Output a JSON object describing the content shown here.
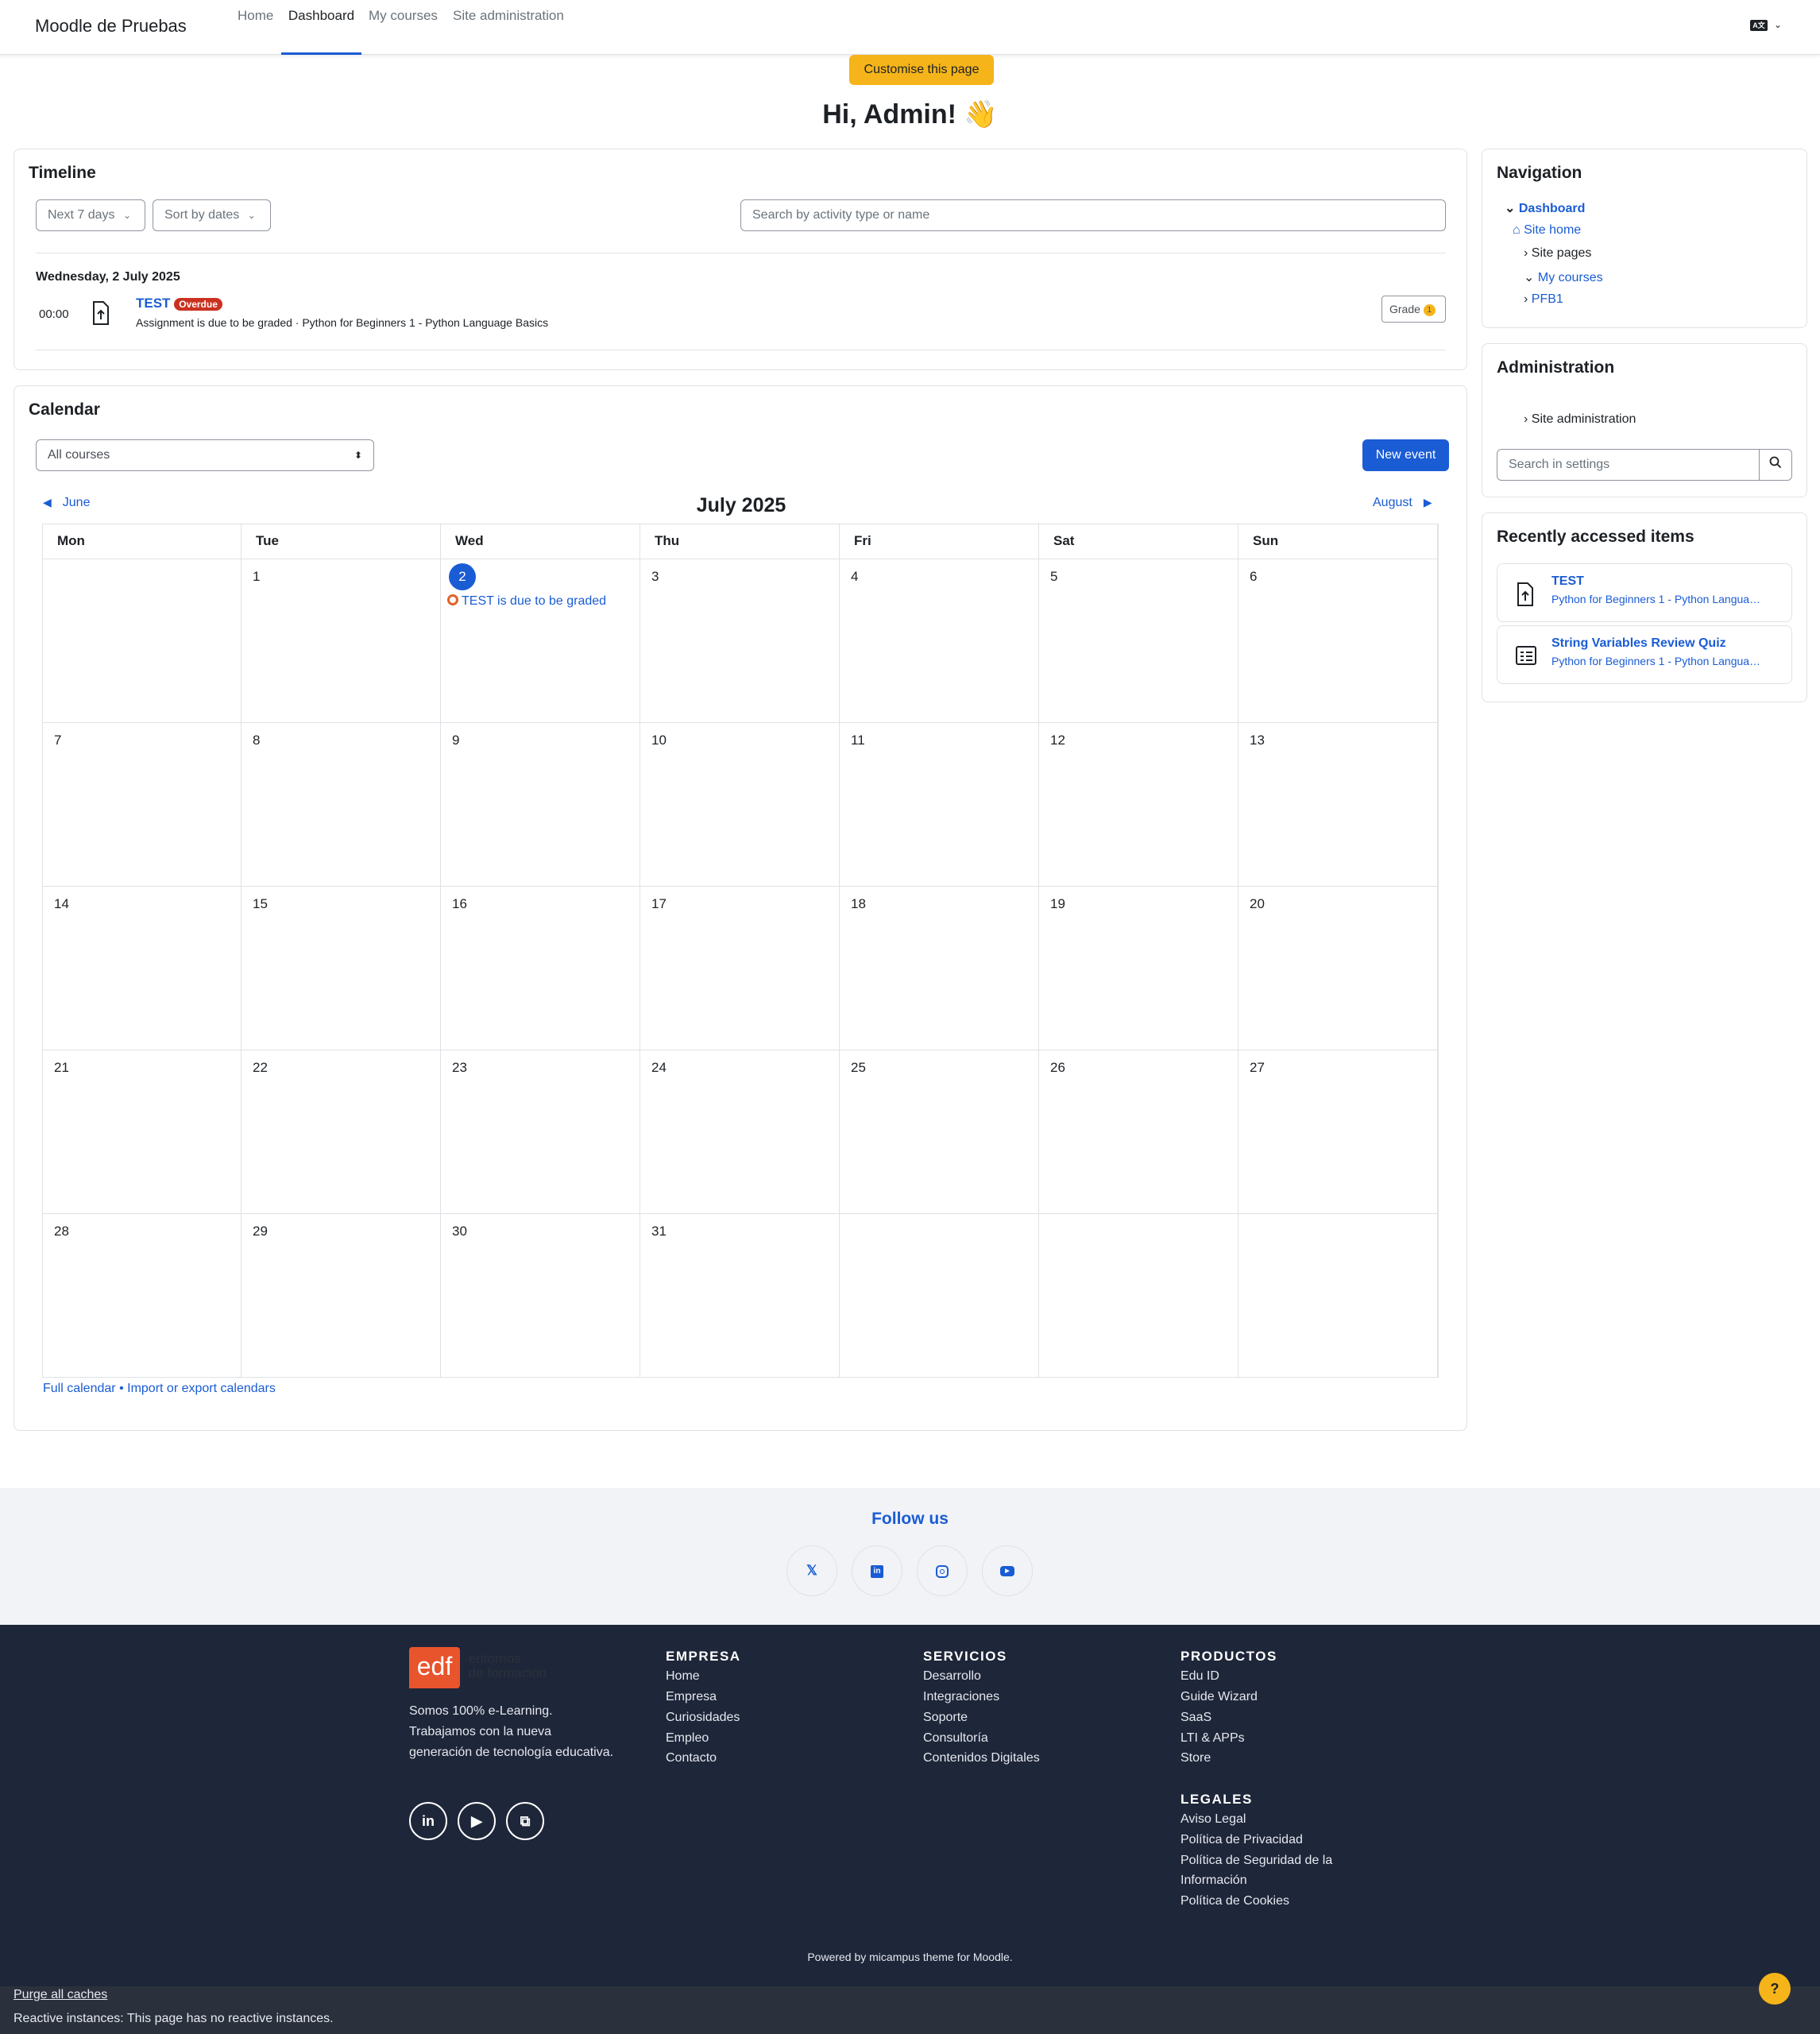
{
  "navbar": {
    "brand": "Moodle de Pruebas",
    "items": [
      {
        "label": "Home"
      },
      {
        "label": "Dashboard"
      },
      {
        "label": "My courses"
      },
      {
        "label": "Site administration"
      }
    ],
    "lang_icon": "language-icon"
  },
  "page": {
    "customise_label": "Customise this page",
    "greeting": "Hi, Admin! 👋"
  },
  "timeline": {
    "title": "Timeline",
    "filter_label": "Next 7 days",
    "sort_label": "Sort by dates",
    "search_placeholder": "Search by activity type or name",
    "date_heading": "Wednesday, 2 July 2025",
    "event": {
      "time": "00:00",
      "name": "TEST",
      "badge": "Overdue",
      "description": "Assignment is due to be graded · Python for Beginners 1 - Python Language Basics",
      "action": "Grade",
      "action_count": "1"
    }
  },
  "calendar": {
    "title": "Calendar",
    "course_select": "All courses",
    "new_event_label": "New event",
    "prev_month": "June",
    "next_month": "August",
    "month_title": "July 2025",
    "weekdays": [
      "Mon",
      "Tue",
      "Wed",
      "Thu",
      "Fri",
      "Sat",
      "Sun"
    ],
    "weeks": [
      [
        "",
        "1",
        "2",
        "3",
        "4",
        "5",
        "6"
      ],
      [
        "7",
        "8",
        "9",
        "10",
        "11",
        "12",
        "13"
      ],
      [
        "14",
        "15",
        "16",
        "17",
        "18",
        "19",
        "20"
      ],
      [
        "21",
        "22",
        "23",
        "24",
        "25",
        "26",
        "27"
      ],
      [
        "28",
        "29",
        "30",
        "31",
        "",
        "",
        ""
      ]
    ],
    "today": "2",
    "event_text": "TEST is due to be graded",
    "full_calendar": "Full calendar",
    "separator": "•",
    "import_export": "Import or export calendars"
  },
  "navigation": {
    "title": "Navigation",
    "items": [
      {
        "label": "Dashboard"
      },
      {
        "label": "Site home"
      },
      {
        "label": "Site pages"
      },
      {
        "label": "My courses"
      },
      {
        "label": "PFB1"
      }
    ]
  },
  "administration": {
    "title": "Administration",
    "item": "Site administration",
    "search_placeholder": "Search in settings"
  },
  "recent": {
    "title": "Recently accessed items",
    "items": [
      {
        "name": "TEST",
        "course": "Python for Beginners 1 - Python Langua…",
        "icon": "assignment-icon"
      },
      {
        "name": "String Variables Review Quiz",
        "course": "Python for Beginners 1 - Python Langua…",
        "icon": "quiz-icon"
      }
    ]
  },
  "follow": {
    "title": "Follow us",
    "icons": [
      "x-icon",
      "linkedin-icon",
      "instagram-icon",
      "youtube-icon"
    ]
  },
  "footer": {
    "logo_text": "edf",
    "logo_sub1": "entornos",
    "logo_sub2": "de formación",
    "about": [
      "Somos 100% e-Learning.",
      "Trabajamos con la nueva",
      "generación de tecnología educativa."
    ],
    "empresa": {
      "title": "EMPRESA",
      "links": [
        "Home",
        "Empresa",
        "Curiosidades",
        "Empleo",
        "Contacto"
      ]
    },
    "servicios": {
      "title": "SERVICIOS",
      "links": [
        "Desarrollo",
        "Integraciones",
        "Soporte",
        "Consultoría",
        "Contenidos Digitales"
      ]
    },
    "productos": {
      "title": "PRODUCTOS",
      "links": [
        "Edu ID",
        "Guide Wizard",
        "SaaS",
        "LTI & APPs",
        "Store"
      ]
    },
    "legales": {
      "title": "LEGALES",
      "links": [
        "Aviso Legal",
        "Política de Privacidad",
        "Política de Seguridad de la",
        "Información",
        "Política de Cookies"
      ]
    },
    "powered": "Powered by micampus theme for Moodle."
  },
  "bottom": {
    "purge": "Purge all caches",
    "reactive": "Reactive instances: This page has no reactive instances.",
    "help": "?"
  },
  "colors": {
    "accent": "#1a5cd4",
    "warning": "#f5b41a",
    "danger": "#ca3120",
    "footer_bg": "#1e2639"
  }
}
